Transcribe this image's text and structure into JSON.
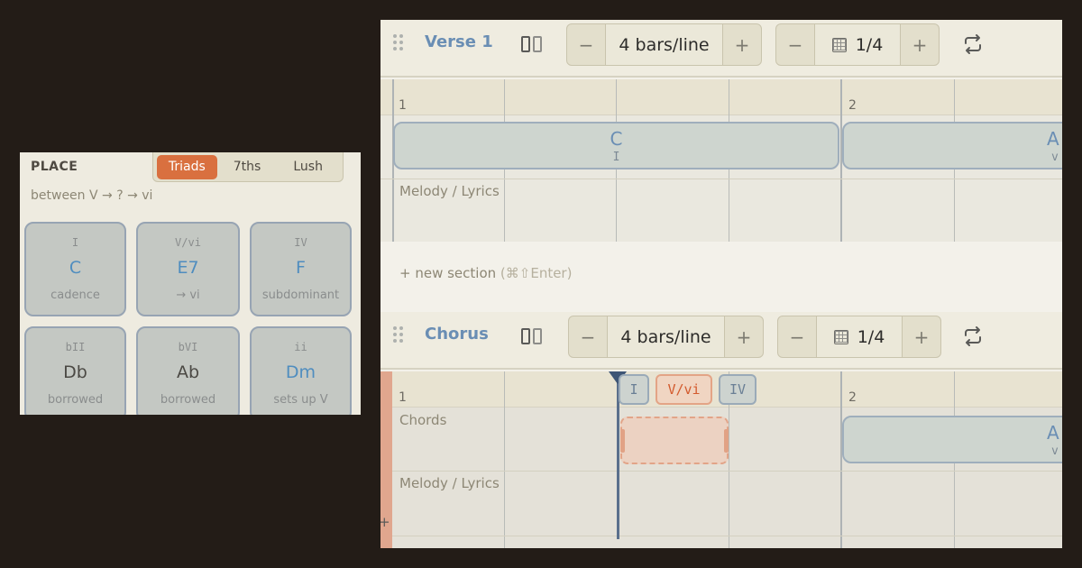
{
  "palette": {
    "title": "PLACE",
    "voicing_tabs": [
      {
        "label": "Triads",
        "active": true
      },
      {
        "label": "7ths",
        "active": false
      },
      {
        "label": "Lush",
        "active": false
      }
    ],
    "context": "between V → ? → vi",
    "cards": [
      {
        "roman": "I",
        "name": "C",
        "desc": "cadence",
        "tone": "diatonic"
      },
      {
        "roman": "V/vi",
        "name": "E7",
        "desc": "→ vi",
        "tone": "diatonic"
      },
      {
        "roman": "IV",
        "name": "F",
        "desc": "subdominant",
        "tone": "diatonic"
      },
      {
        "roman": "bII",
        "name": "Db",
        "desc": "borrowed",
        "tone": "borrowed"
      },
      {
        "roman": "bVI",
        "name": "Ab",
        "desc": "borrowed",
        "tone": "borrowed"
      },
      {
        "roman": "ii",
        "name": "Dm",
        "desc": "sets up V",
        "tone": "diatonic"
      }
    ]
  },
  "sections": [
    {
      "name": "Verse 1",
      "bars_per_line": "4 bars/line",
      "grid": "1/4",
      "bar_numbers": [
        "1",
        "2"
      ],
      "rows": [
        "Melody / Lyrics"
      ],
      "chords": [
        {
          "name": "C",
          "roman": "I"
        },
        {
          "name": "A",
          "roman": "v"
        }
      ]
    },
    {
      "name": "Chorus",
      "bars_per_line": "4 bars/line",
      "grid": "1/4",
      "bar_numbers": [
        "1",
        "2"
      ],
      "rows": [
        "Chords",
        "Melody / Lyrics"
      ],
      "chords": [
        {
          "name": "A",
          "roman": "v"
        }
      ],
      "suggestions": [
        "I",
        "V/vi",
        "IV"
      ]
    }
  ],
  "new_section": {
    "label": "+ new section",
    "shortcut": "(⌘⇧Enter)"
  },
  "stepper": {
    "minus": "−",
    "plus": "+"
  },
  "plus_mark": "+",
  "colors": {
    "accent": "#d9703f",
    "chord_blue": "#6a8eb4",
    "background": "#231c17",
    "panel": "#eeebe0"
  },
  "icons": [
    "drag-handle-icon",
    "split-layout-icon",
    "grid-icon",
    "loop-icon",
    "playhead-icon"
  ]
}
